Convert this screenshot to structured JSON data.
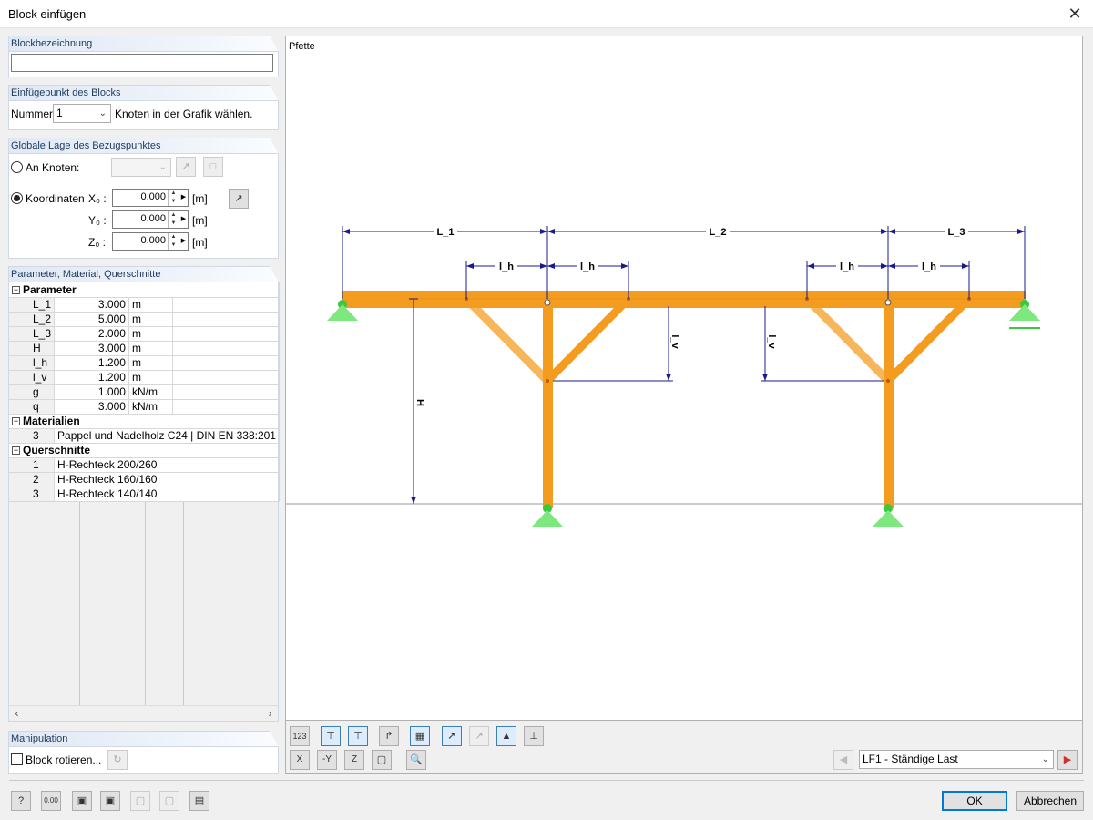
{
  "window": {
    "title": "Block einfügen",
    "close_glyph": "✕"
  },
  "blockname": {
    "header": "Blockbezeichnung",
    "value": ""
  },
  "insertion": {
    "header": "Einfügepunkt des Blocks",
    "nummer_label": "Nummer:",
    "nummer_value": "1",
    "hint": "Knoten in der Grafik wählen."
  },
  "position": {
    "header": "Globale Lage des Bezugspunktes",
    "an_knoten": "An Knoten:",
    "koordinaten": "Koordinaten",
    "x_label": "X₀ :",
    "y_label": "Y₀ :",
    "z_label": "Z₀ :",
    "x_value": "0.000",
    "y_value": "0.000",
    "z_value": "0.000",
    "unit": "[m]"
  },
  "params": {
    "header": "Parameter, Material, Querschnitte",
    "sec_parameter": "Parameter",
    "parameters": [
      {
        "name": "L_1",
        "value": "3.000",
        "unit": "m"
      },
      {
        "name": "L_2",
        "value": "5.000",
        "unit": "m"
      },
      {
        "name": "L_3",
        "value": "2.000",
        "unit": "m"
      },
      {
        "name": "H",
        "value": "3.000",
        "unit": "m"
      },
      {
        "name": "l_h",
        "value": "1.200",
        "unit": "m"
      },
      {
        "name": "l_v",
        "value": "1.200",
        "unit": "m"
      },
      {
        "name": "g",
        "value": "1.000",
        "unit": "kN/m"
      },
      {
        "name": "q",
        "value": "3.000",
        "unit": "kN/m"
      }
    ],
    "sec_materialien": "Materialien",
    "materials": [
      {
        "no": "3",
        "text": "Pappel und Nadelholz C24 | DIN EN 338:201"
      }
    ],
    "sec_querschnitte": "Querschnitte",
    "sections": [
      {
        "no": "1",
        "text": "H-Rechteck 200/260"
      },
      {
        "no": "2",
        "text": "H-Rechteck 160/160"
      },
      {
        "no": "3",
        "text": "H-Rechteck 140/140"
      }
    ]
  },
  "manipulation": {
    "header": "Manipulation",
    "rotate_label": "Block rotieren..."
  },
  "graphic": {
    "title": "Pfette",
    "dims": {
      "L1": "L_1",
      "L2": "L_2",
      "L3": "L_3",
      "lh": "l_h",
      "lv": "l_v",
      "H": "H"
    }
  },
  "toolbar": {
    "loadcase": "LF1 - Ständige Last"
  },
  "buttons": {
    "ok": "OK",
    "cancel": "Abbrechen"
  },
  "colors": {
    "member": "#f39c1f",
    "member_light": "#f7b65a",
    "support": "#5de05d",
    "dimension": "#1a1a8c"
  }
}
